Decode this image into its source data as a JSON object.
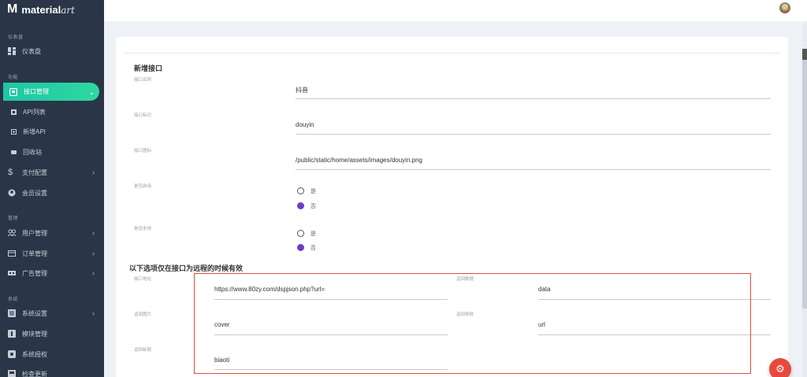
{
  "app": {
    "logo_letter": "M",
    "logo_main": "material",
    "logo_accent": "art"
  },
  "sidebar": {
    "sections": {
      "dashboard": "仪表盘",
      "features": "功能",
      "manage": "管理",
      "system": "系统"
    },
    "items": {
      "dashboard": "仪表盘",
      "api_manage": "接口管理",
      "api_list": "API列表",
      "new_api": "新增API",
      "recycle": "回收站",
      "payment": "支付配置",
      "member": "会员设置",
      "user_manage": "用户管理",
      "order_manage": "订单管理",
      "ad_manage": "广告管理",
      "sys_settings": "系统设置",
      "module_manage": "模块管理",
      "sys_auth": "系统授权",
      "check_update": "检查更新"
    }
  },
  "form": {
    "title": "新增接口",
    "fields": {
      "name": {
        "label": "接口名称",
        "value": "抖音"
      },
      "ident": {
        "label": "接口标识",
        "value": "douyin"
      },
      "icon": {
        "label": "接口图标",
        "value": "/public/static/home/assets/images/douyin.png"
      },
      "enabled": {
        "label": "是否启用",
        "opt_yes": "是",
        "opt_no": "否",
        "selected": "否"
      },
      "local": {
        "label": "是否本地",
        "opt_yes": "是",
        "opt_no": "否",
        "selected": "否"
      }
    },
    "remote_title": "以下选项仅在接口为远程的时候有效",
    "remote": {
      "url": {
        "label": "接口地址",
        "value": "https://www.80zy.com/dspjson.php?url="
      },
      "data": {
        "label": "返回数据",
        "value": "data"
      },
      "image": {
        "label": "返回图片",
        "value": "cover"
      },
      "video": {
        "label": "返回视频",
        "value": "url"
      },
      "title": {
        "label": "返回标题",
        "value": "biaoti"
      }
    }
  },
  "colors": {
    "sidebar": "#2a3647",
    "accent": "#2fd8a0",
    "radio": "#6b3fc4",
    "fab": "#e8493d",
    "highlight": "#e34b40"
  }
}
